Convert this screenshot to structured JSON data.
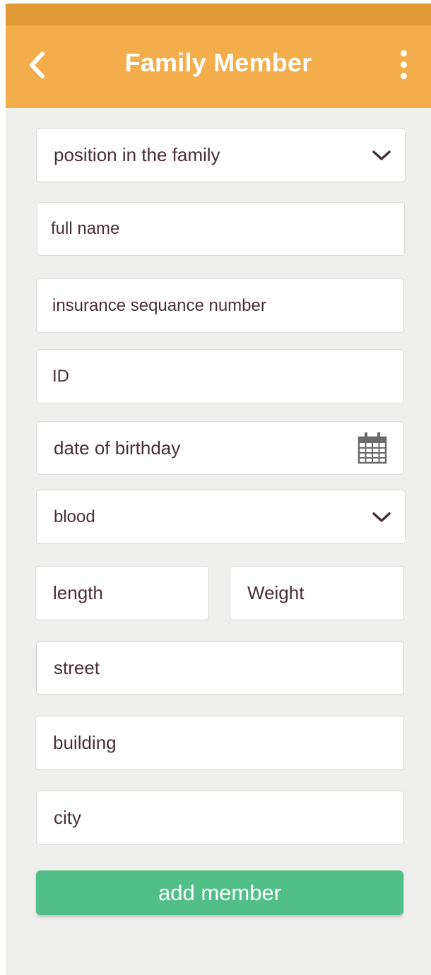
{
  "header": {
    "title": "Family Member",
    "back_icon": "chevron-left-icon",
    "menu_icon": "more-vertical-icon",
    "accent_color": "#f3ad4a",
    "status_bar_color": "#e09a36"
  },
  "form": {
    "position": {
      "placeholder": "position in the family",
      "icon": "chevron-down-icon"
    },
    "full_name": {
      "placeholder": "full name"
    },
    "insurance": {
      "placeholder": "insurance sequance number"
    },
    "id": {
      "placeholder": "ID"
    },
    "birthday": {
      "placeholder": "date of birthday",
      "icon": "calendar-icon"
    },
    "blood": {
      "placeholder": "blood",
      "icon": "chevron-down-icon"
    },
    "length": {
      "placeholder": "length"
    },
    "weight": {
      "placeholder": "Weight"
    },
    "street": {
      "placeholder": "street"
    },
    "building": {
      "placeholder": "building"
    },
    "city": {
      "placeholder": "city"
    }
  },
  "actions": {
    "add_label": "add member",
    "button_color": "#53bf88"
  }
}
